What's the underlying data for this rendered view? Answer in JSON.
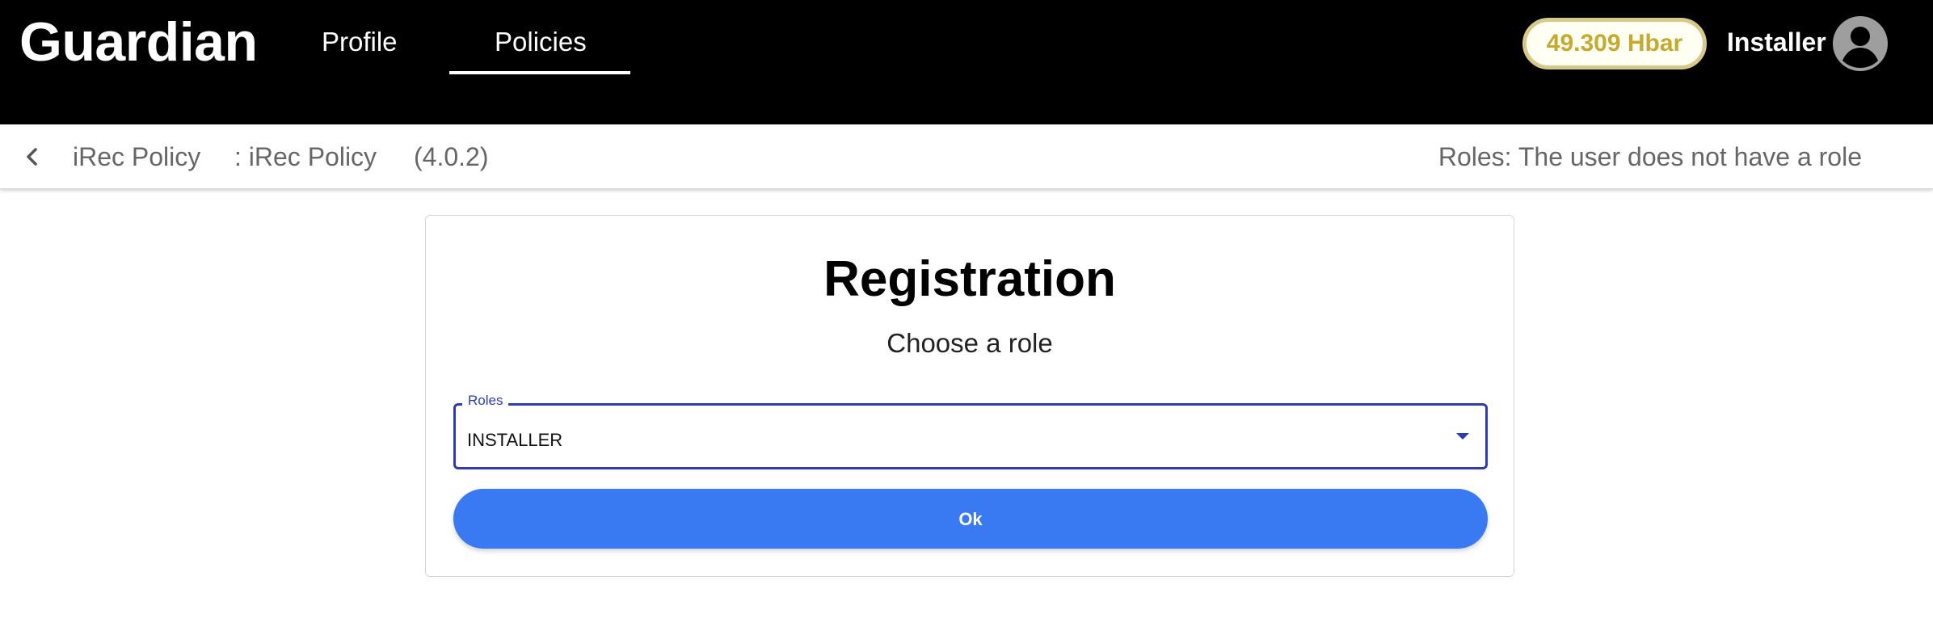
{
  "app": {
    "brand": "Guardian",
    "nav": [
      {
        "label": "Profile",
        "active": false
      },
      {
        "label": "Policies",
        "active": true
      }
    ],
    "balance": "49.309 Hbar",
    "user": "Installer",
    "icons": {
      "avatar": "account-circle-icon",
      "back": "chevron-left-icon",
      "dropdown": "arrow-drop-down-icon"
    }
  },
  "subheader": {
    "crumbs": [
      "iRec Policy",
      ": iRec Policy",
      "(4.0.2)"
    ],
    "roles": "Roles: The user does not have a role"
  },
  "registration": {
    "title": "Registration",
    "subtitle": "Choose a role",
    "select": {
      "legend": "Roles",
      "value": "INSTALLER"
    },
    "ok_label": "Ok"
  },
  "colors": {
    "header_bg": "#000000",
    "balance_text": "#c4aa2e",
    "balance_border": "#d6c98a",
    "select_accent": "#2f3bb0",
    "ok_button": "#3979f2"
  }
}
